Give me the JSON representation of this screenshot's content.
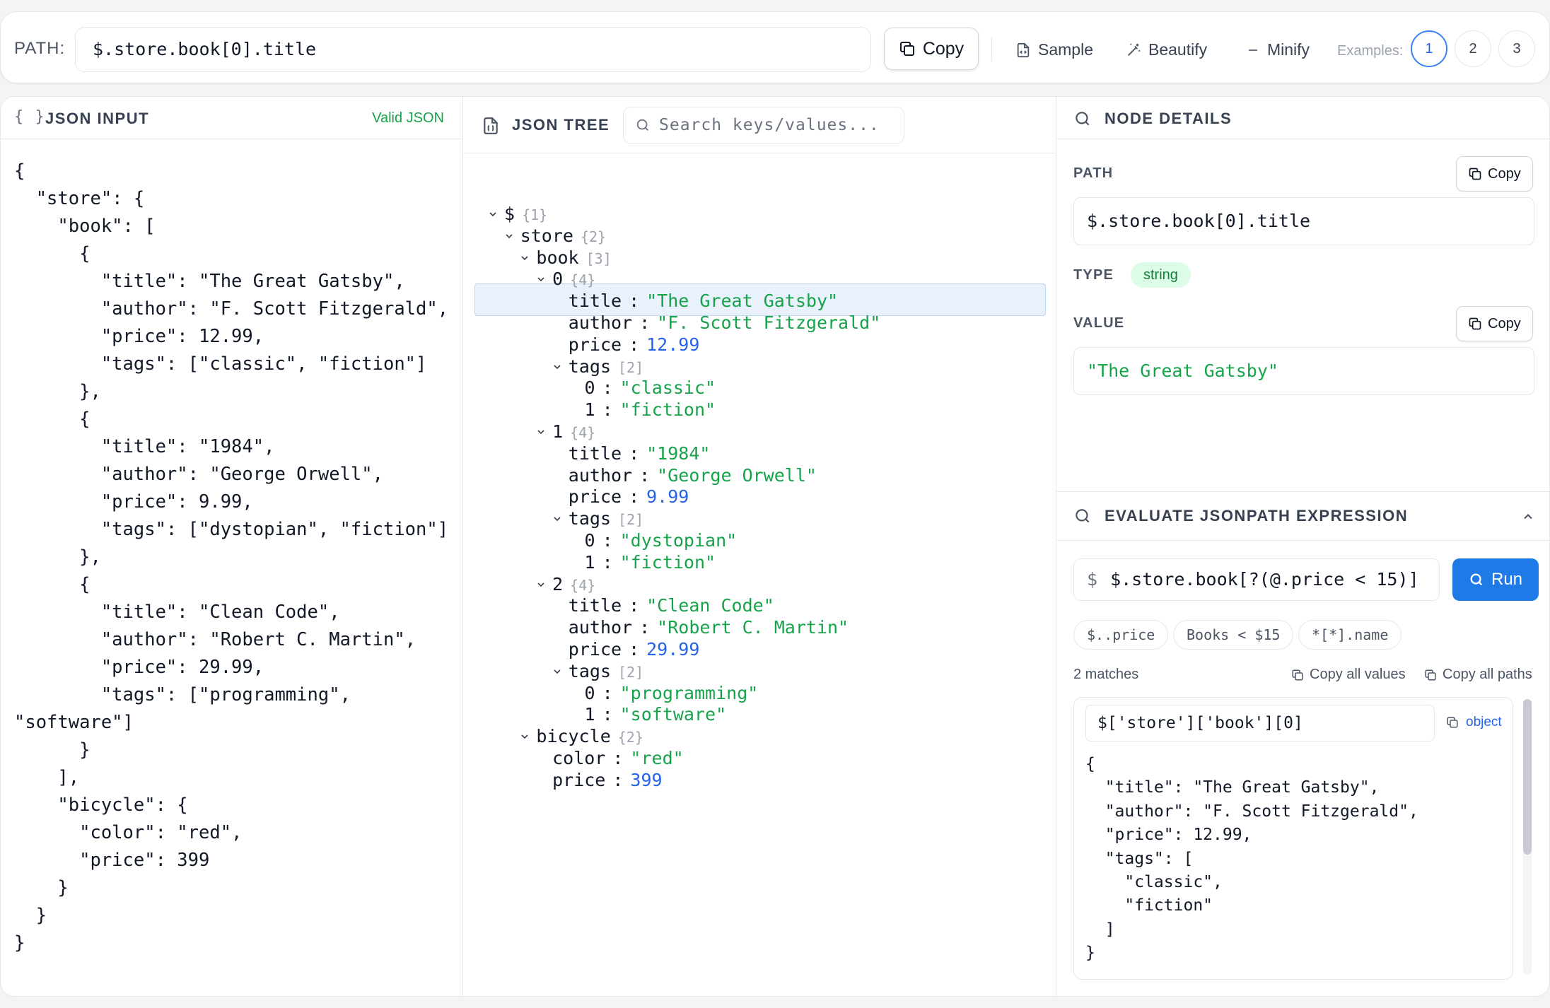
{
  "toolbar": {
    "path_label": "PATH:",
    "path_value": "$.store.book[0].title",
    "copy_label": "Copy",
    "sample_label": "Sample",
    "beautify_label": "Beautify",
    "minify_label": "Minify",
    "examples_label": "Examples:",
    "examples": [
      "1",
      "2",
      "3"
    ],
    "active_example": "1"
  },
  "input_panel": {
    "title": "JSON INPUT",
    "brace_icon": "{ }",
    "status": "Valid JSON",
    "lines": [
      "{",
      "  \"store\": {",
      "    \"book\": [",
      "      {",
      "        \"title\": \"The Great Gatsby\",",
      "        \"author\": \"F. Scott Fitzgerald\",",
      "        \"price\": 12.99,",
      "        \"tags\": [\"classic\", \"fiction\"]",
      "      },",
      "      {",
      "        \"title\": \"1984\",",
      "        \"author\": \"George Orwell\",",
      "        \"price\": 9.99,",
      "        \"tags\": [\"dystopian\", \"fiction\"]",
      "      },",
      "      {",
      "        \"title\": \"Clean Code\",",
      "        \"author\": \"Robert C. Martin\",",
      "        \"price\": 29.99,",
      "        \"tags\": [\"programming\",",
      "\"software\"]",
      "      }",
      "    ],",
      "    \"bicycle\": {",
      "      \"color\": \"red\",",
      "      \"price\": 399",
      "    }",
      "  }",
      "}"
    ]
  },
  "tree_panel": {
    "title": "JSON TREE",
    "search_placeholder": "Search keys/values...",
    "rows": [
      {
        "key": "$",
        "count": "{1}",
        "depth": 0,
        "expandable": true
      },
      {
        "key": "store",
        "count": "{2}",
        "depth": 1,
        "expandable": true
      },
      {
        "key": "book",
        "count": "[3]",
        "depth": 2,
        "expandable": true
      },
      {
        "key": "0",
        "count": "{4}",
        "depth": 3,
        "expandable": true
      },
      {
        "key": "title",
        "value": "\"The Great Gatsby\"",
        "vtype": "str",
        "depth": 4,
        "selected": true
      },
      {
        "key": "author",
        "value": "\"F. Scott Fitzgerald\"",
        "vtype": "str",
        "depth": 4
      },
      {
        "key": "price",
        "value": "12.99",
        "vtype": "num",
        "depth": 4
      },
      {
        "key": "tags",
        "count": "[2]",
        "depth": 4,
        "expandable": true
      },
      {
        "key": "0",
        "value": "\"classic\"",
        "vtype": "str",
        "depth": 5
      },
      {
        "key": "1",
        "value": "\"fiction\"",
        "vtype": "str",
        "depth": 5
      },
      {
        "key": "1",
        "count": "{4}",
        "depth": 3,
        "expandable": true
      },
      {
        "key": "title",
        "value": "\"1984\"",
        "vtype": "str",
        "depth": 4
      },
      {
        "key": "author",
        "value": "\"George Orwell\"",
        "vtype": "str",
        "depth": 4
      },
      {
        "key": "price",
        "value": "9.99",
        "vtype": "num",
        "depth": 4
      },
      {
        "key": "tags",
        "count": "[2]",
        "depth": 4,
        "expandable": true
      },
      {
        "key": "0",
        "value": "\"dystopian\"",
        "vtype": "str",
        "depth": 5
      },
      {
        "key": "1",
        "value": "\"fiction\"",
        "vtype": "str",
        "depth": 5
      },
      {
        "key": "2",
        "count": "{4}",
        "depth": 3,
        "expandable": true
      },
      {
        "key": "title",
        "value": "\"Clean Code\"",
        "vtype": "str",
        "depth": 4
      },
      {
        "key": "author",
        "value": "\"Robert C. Martin\"",
        "vtype": "str",
        "depth": 4
      },
      {
        "key": "price",
        "value": "29.99",
        "vtype": "num",
        "depth": 4
      },
      {
        "key": "tags",
        "count": "[2]",
        "depth": 4,
        "expandable": true
      },
      {
        "key": "0",
        "value": "\"programming\"",
        "vtype": "str",
        "depth": 5
      },
      {
        "key": "1",
        "value": "\"software\"",
        "vtype": "str",
        "depth": 5
      },
      {
        "key": "bicycle",
        "count": "{2}",
        "depth": 2,
        "expandable": true
      },
      {
        "key": "color",
        "value": "\"red\"",
        "vtype": "str",
        "depth": 3
      },
      {
        "key": "price",
        "value": "399",
        "vtype": "num",
        "depth": 3
      }
    ]
  },
  "details_panel": {
    "title": "NODE DETAILS",
    "path_label": "PATH",
    "path_value": "$.store.book[0].title",
    "copy_label": "Copy",
    "type_label": "TYPE",
    "type_value": "string",
    "value_label": "VALUE",
    "value": "\"The Great Gatsby\""
  },
  "evaluate_panel": {
    "title": "EVALUATE JSONPATH EXPRESSION",
    "prefix": "$",
    "expression": "$.store.book[?(@.price < 15)]",
    "run_label": "Run",
    "chips": [
      "$..price",
      "Books < $15",
      "*[*].name"
    ],
    "matches_label": "2 matches",
    "copy_values_label": "Copy all values",
    "copy_paths_label": "Copy all paths",
    "result": {
      "path": "$['store']['book'][0]",
      "type": "object",
      "json_lines": [
        "{",
        "  \"title\": \"The Great Gatsby\",",
        "  \"author\": \"F. Scott Fitzgerald\",",
        "  \"price\": 12.99,",
        "  \"tags\": [",
        "    \"classic\",",
        "    \"fiction\"",
        "  ]",
        "}"
      ]
    }
  },
  "colors": {
    "accent": "#1f7ae8",
    "string": "#16a34a",
    "number": "#2563eb",
    "valid": "#16a34a",
    "selection": "#e8f1fc"
  }
}
